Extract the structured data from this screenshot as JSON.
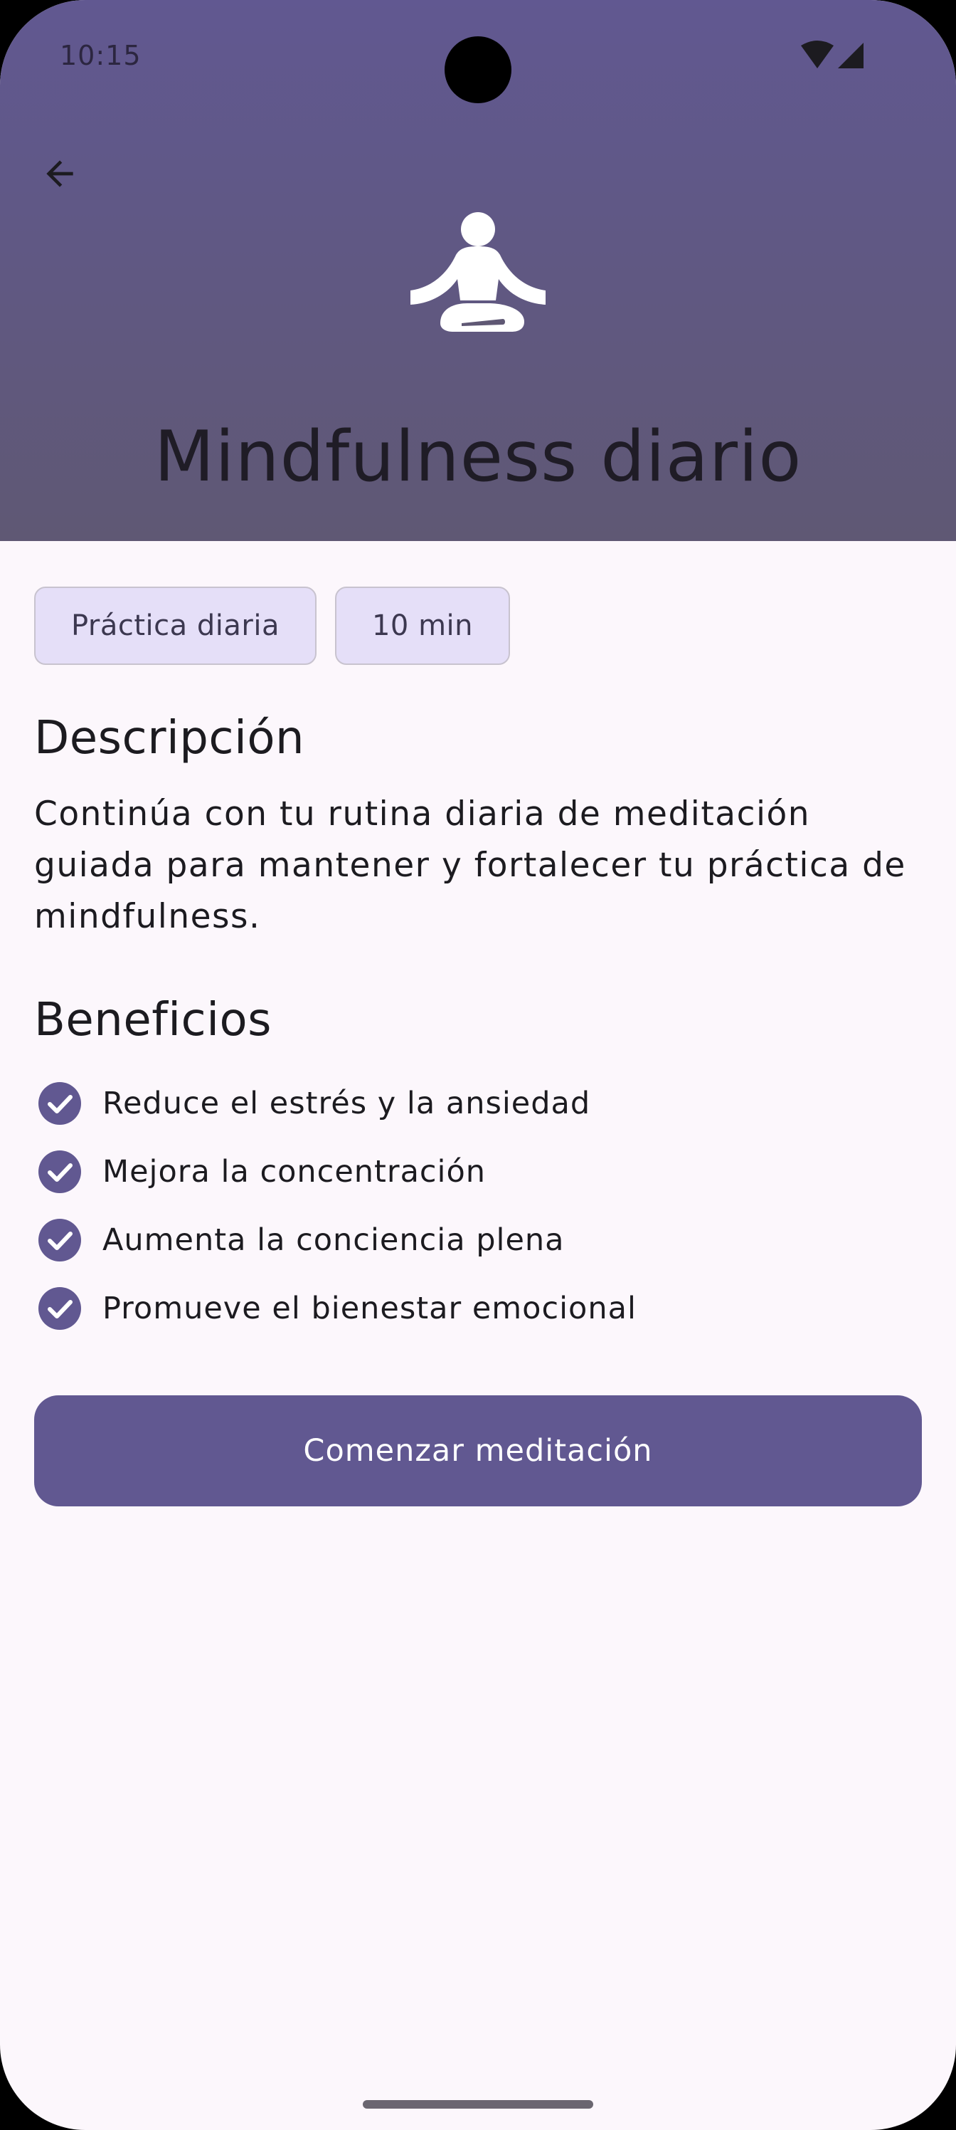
{
  "status_bar": {
    "time": "10:15",
    "icons": [
      "wifi-icon",
      "signal-icon"
    ]
  },
  "header": {
    "back_icon": "arrow-back-icon",
    "hero_icon": "meditation-icon",
    "title": "Mindfulness diario"
  },
  "chips": [
    {
      "label": "Práctica diaria"
    },
    {
      "label": "10 min"
    }
  ],
  "description": {
    "title": "Descripción",
    "text": "Continúa con tu rutina diaria de meditación guiada para mantener y fortalecer tu práctica de mindfulness."
  },
  "benefits": {
    "title": "Beneficios",
    "icon": "check-circle-icon",
    "items": [
      "Reduce el estrés y la ansiedad",
      "Mejora la concentración",
      "Aumenta la conciencia plena",
      "Promueve el bienestar emocional"
    ]
  },
  "actions": {
    "start_label": "Comenzar meditación"
  },
  "colors": {
    "primary": "#615891",
    "background": "#FCF7FC",
    "chip_background": "#E5DFF8"
  }
}
